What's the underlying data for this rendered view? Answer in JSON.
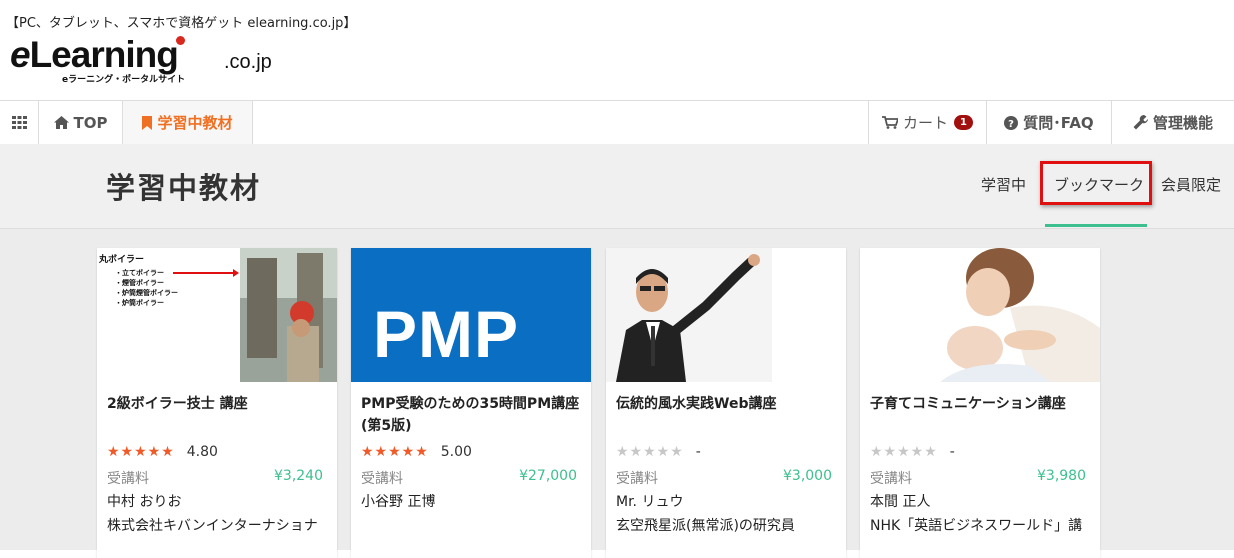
{
  "header": {
    "tagline": "【PC、タブレット、スマホで資格ゲット elearning.co.jp】",
    "logo": {
      "main": "Learning",
      "e": "e",
      "domain": ".co.jp",
      "sub": "eラーニング・ポータルサイト"
    }
  },
  "nav": {
    "grid_icon": "grid-icon",
    "top": "TOP",
    "studying": "学習中教材",
    "cart": "カート",
    "cart_count": "1",
    "faq": "質問･FAQ",
    "admin": "管理機能"
  },
  "page": {
    "title": "学習中教材",
    "tabs": {
      "studying": "学習中",
      "bookmark": "ブックマーク",
      "members": "会員限定"
    },
    "active_tab": "ブックマーク"
  },
  "courses": [
    {
      "title": "2級ボイラー技士 講座",
      "stars": "★★★★★",
      "rating": "4.80",
      "fee_label": "受講料",
      "price": "¥3,240",
      "author": "中村 おりお",
      "org": "株式会社キバンインターナショナ",
      "thumb": {
        "heading": "丸ボイラー",
        "items": [
          "・立てボイラー",
          "・煙管ボイラー",
          "・炉筒煙管ボイラー",
          "・炉筒ボイラー"
        ]
      }
    },
    {
      "title": "PMP受験のための35時間PM講座(第5版)",
      "stars": "★★★★★",
      "rating": "5.00",
      "fee_label": "受講料",
      "price": "¥27,000",
      "author": "小谷野 正博",
      "org": "",
      "thumb": {
        "text": "PMP"
      }
    },
    {
      "title": "伝統的風水実践Web講座",
      "stars": "★★★★★",
      "rating": "-",
      "fee_label": "受講料",
      "price": "¥3,000",
      "author": "Mr. リュウ",
      "org": "玄空飛星派(無常派)の研究員"
    },
    {
      "title": "子育てコミュニケーション講座",
      "stars": "★★★★★",
      "rating": "-",
      "fee_label": "受講料",
      "price": "¥3,980",
      "author": "本間 正人",
      "org": "NHK「英語ビジネスワールド」講"
    }
  ],
  "colors": {
    "accent_orange": "#f07023",
    "price_green": "#3dbf8f",
    "star_orange": "#f05a28",
    "badge_red": "#a10f0f",
    "highlight_red": "#e01010"
  }
}
